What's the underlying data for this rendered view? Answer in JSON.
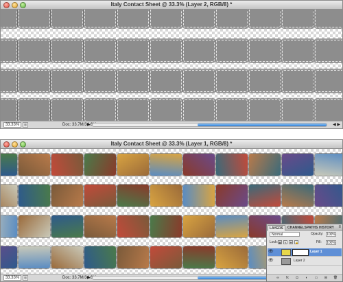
{
  "top_window": {
    "title": "Italy Contact Sheet @ 33.3% (Layer 2, RGB/8) *",
    "zoom": "33.33%",
    "doc_size": "Doc: 33.7M/34.6M"
  },
  "bottom_window": {
    "title": "Italy Contact Sheet @ 33.3% (Layer 1, RGB/8) *",
    "zoom": "33.33%",
    "doc_size": "Doc: 33.7M/34.6M"
  },
  "layers_panel": {
    "tabs": [
      "LAYERS",
      "CHANNELS",
      "PATHS",
      "HISTORY"
    ],
    "blend_mode": "Normal",
    "opacity_label": "Opacity:",
    "opacity": "100%",
    "lock_label": "Lock:",
    "fill_label": "Fill:",
    "fill": "100%",
    "layers": [
      {
        "name": "Layer 1",
        "selected": true
      },
      {
        "name": "Layer 2",
        "selected": false
      }
    ],
    "bottom_buttons": [
      "fx",
      "mask",
      "adj",
      "group",
      "new",
      "trash"
    ]
  },
  "colors": {
    "selection_blue": "#5f8fd6",
    "scroll_blue": "#2f7fd4",
    "thumb_gray": "#8d8d8d"
  }
}
